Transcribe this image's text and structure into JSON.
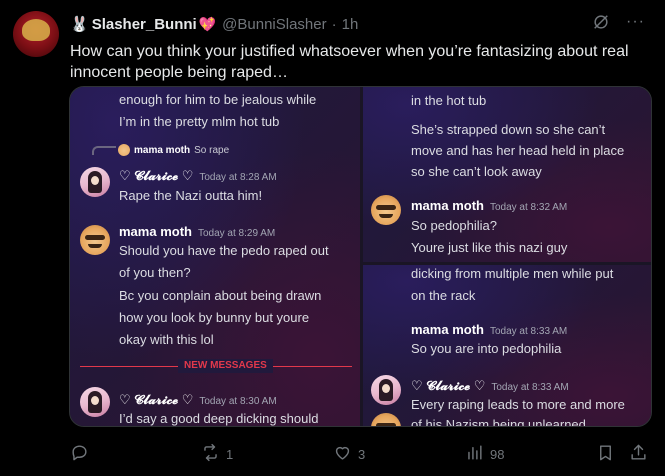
{
  "post": {
    "display_name": "Slasher_Bunni",
    "rabbit_emoji": "🐰",
    "heart_emoji": "💖",
    "handle": "@BunniSlasher",
    "separator": "·",
    "time": "1h",
    "more_label": "···",
    "text": "How can you think your justified whatsoever when you’re fantasizing about real innocent people being raped…"
  },
  "media": {
    "left": {
      "top_text_1": "enough for him to be jealous while",
      "top_text_2": "I’m in the pretty mlm hot tub",
      "reply_name": "mama moth",
      "reply_text": "So rape",
      "m1_name": "♡ 𝓒𝓵𝓪𝓻𝓲𝓬𝓮 ♡",
      "m1_time": "Today at 8:28 AM",
      "m1_text": "Rape the Nazi outta him!",
      "m2_name": "mama moth",
      "m2_time": "Today at 8:29 AM",
      "m2_text_1": "Should you have the pedo raped out",
      "m2_text_2": "of you then?",
      "m2_text_3": "Bc you conplain about being drawn",
      "m2_text_4": "how you look by bunny but youre",
      "m2_text_5": "okay with this lol",
      "new_messages": "NEW MESSAGES",
      "m3_name": "♡ 𝓒𝓵𝓪𝓻𝓲𝓬𝓮 ♡",
      "m3_time": "Today at 8:30 AM",
      "m3_text": "I’d say a good deep dicking should"
    },
    "right_top": {
      "t1": "in the hot tub",
      "t2": "She’s strapped down so she can’t",
      "t3": "move and has her head held in place",
      "t4": "so she can’t look away",
      "m_name": "mama moth",
      "m_time": "Today at 8:32 AM",
      "m_text_1": "So pedophilia?",
      "m_text_2": "Youre just like this nazi guy"
    },
    "right_bottom": {
      "t1": "dicking from multiple men while put",
      "t2": "on the rack",
      "m1_name": "mama moth",
      "m1_time": "Today at 8:33 AM",
      "m1_text": "So you are into pedophilia",
      "m2_name": "♡ 𝓒𝓵𝓪𝓻𝓲𝓬𝓮 ♡",
      "m2_time": "Today at 8:33 AM",
      "m2_text_1": "Every raping leads to more and more",
      "m2_text_2": "of his Nazism being unlearned"
    }
  },
  "actions": {
    "replies": "",
    "reposts": "1",
    "likes": "3",
    "views": "98"
  },
  "colors": {
    "accent_new_messages": "#e2384b",
    "muted": "#71767b",
    "text": "#e7e9ea"
  }
}
